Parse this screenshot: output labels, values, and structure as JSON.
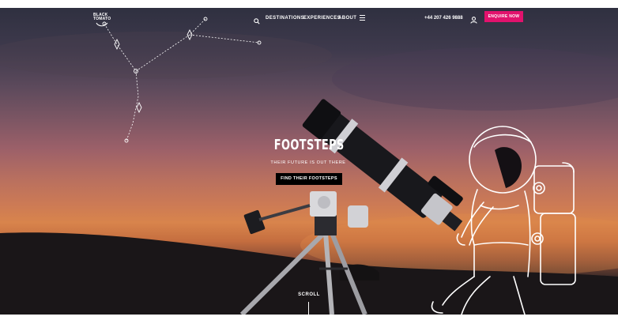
{
  "header": {
    "logo_text": "BLACK TOMATO",
    "nav_links": [
      "DESTINATIONS",
      "EXPERIENCES",
      "ABOUT"
    ],
    "phone": "+44 207 426 9888",
    "cta_label": "ENQUIRE NOW",
    "icons": {
      "search": "search-icon",
      "menu": "hamburger-menu-icon",
      "account": "user-icon"
    }
  },
  "hero": {
    "title": "FOOTSTEPS",
    "subtitle": "THEIR FUTURE IS OUT THERE",
    "cta_label": "FIND THEIR FOOTSTEPS",
    "scroll_label": "SCROLL"
  },
  "colors": {
    "accent": "#e2126d",
    "cta_bg": "#000000",
    "text": "#ffffff"
  }
}
